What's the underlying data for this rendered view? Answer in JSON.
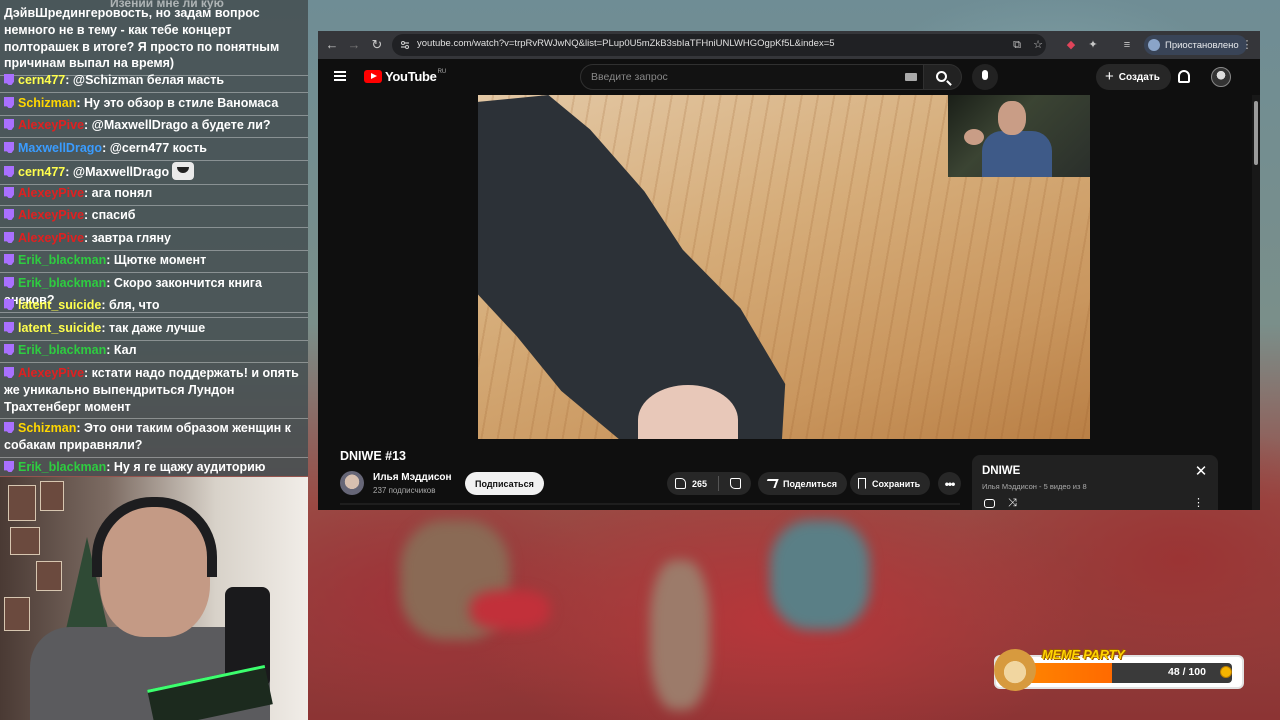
{
  "chat": {
    "top_fade": "Изении мне ли кую",
    "messages": [
      {
        "user": "",
        "user_color": "#ffffff",
        "text": "ДэйвШредингеровость, но задам вопрос немного не в тему - как тебе концерт полторашек в итоге? Я просто по понятным причинам выпал на время)",
        "badge": false
      },
      {
        "user": "cern477",
        "user_color": "#ffff4d",
        "text": ": @Schizman белая масть",
        "badge": true
      },
      {
        "user": "Schizman",
        "user_color": "#ffd700",
        "text": ": Ну это обзор в стиле Ваномаса",
        "badge": true
      },
      {
        "user": "AlexeyPive",
        "user_color": "#e02020",
        "text": ": @MaxwellDrago а будете ли?",
        "badge": true
      },
      {
        "user": "MaxwellDrago",
        "user_color": "#3a9cff",
        "text": ": @cern477 кость",
        "badge": true
      },
      {
        "user": "cern477",
        "user_color": "#ffff4d",
        "text": ": @MaxwellDrago",
        "badge": true,
        "emote": true
      },
      {
        "user": "AlexeyPive",
        "user_color": "#e02020",
        "text": ": ага понял",
        "badge": true
      },
      {
        "user": "AlexeyPive",
        "user_color": "#e02020",
        "text": ": спасиб",
        "badge": true
      },
      {
        "user": "AlexeyPive",
        "user_color": "#e02020",
        "text": ": завтра гляну",
        "badge": true
      },
      {
        "user": "Erik_blackman",
        "user_color": "#2ecc40",
        "text": ": Щютке момент",
        "badge": true
      },
      {
        "user": "Erik_blackman",
        "user_color": "#2ecc40",
        "text": ": Скоро закончится книга анеков?",
        "badge": true
      },
      {
        "user": "latent_suicide",
        "user_color": "#ffff4d",
        "text": ": бля, что",
        "badge": true
      },
      {
        "user": "latent_suicide",
        "user_color": "#ffff4d",
        "text": ": так даже лучше",
        "badge": true
      },
      {
        "user": "Erik_blackman",
        "user_color": "#2ecc40",
        "text": ": Кал",
        "badge": true
      },
      {
        "user": "AlexeyPive",
        "user_color": "#e02020",
        "text": ": кстати надо поддержать! и опять же уникально выпендриться Лундон Трахтенберг момент",
        "badge": true
      },
      {
        "user": "Schizman",
        "user_color": "#ffd700",
        "text": ": Это они таким образом женщин к собакам приравняли?",
        "badge": true
      },
      {
        "user": "Erik_blackman",
        "user_color": "#2ecc40",
        "text": ": Ну я ге щажу аудиторию",
        "badge": true
      }
    ]
  },
  "browser": {
    "url": "youtube.com/watch?v=trpRvRWJwNQ&list=PLup0U5mZkB3sbIaTFHniUNLWHGOgpKf5L&index=5",
    "profile_status": "Приостановлено"
  },
  "youtube": {
    "logo_text": "YouTube",
    "region": "RU",
    "search_placeholder": "Введите запрос",
    "create_label": "Создать",
    "video_title": "DNIWE #13",
    "channel_name": "Илья Мэддисон",
    "subscribers": "237 подписчиков",
    "subscribe_label": "Подписаться",
    "likes": "265",
    "share_label": "Поделиться",
    "save_label": "Сохранить",
    "more_label": "•••",
    "playlist": {
      "title": "DNIWE",
      "subtitle": "Илья Мэддисон - 5 видео из 8",
      "close": "✕"
    }
  },
  "meme_party": {
    "title": "MEME PARTY",
    "count": "48 / 100",
    "progress": 0.48
  }
}
